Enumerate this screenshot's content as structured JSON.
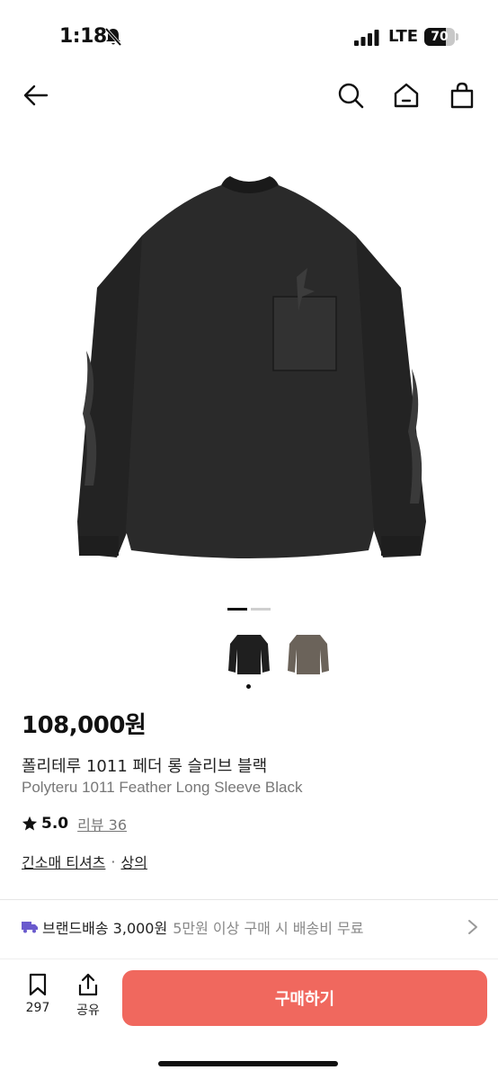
{
  "status_bar": {
    "time": "1:18",
    "network": "LTE",
    "battery": "70",
    "battery_level": 0.7
  },
  "nav": {
    "icons": [
      "back-arrow-icon",
      "search-icon",
      "home-icon",
      "shopping-bag-icon"
    ]
  },
  "gallery": {
    "page_count": 2,
    "current_page": 1,
    "thumbnails": [
      {
        "color": "#1f1f1f",
        "selected": true
      },
      {
        "color": "#6b635a",
        "selected": false
      }
    ]
  },
  "product": {
    "price": "108,000원",
    "name_ko": "폴리테루 1011 페더 롱 슬리브 블랙",
    "name_en": "Polyteru 1011 Feather Long Sleeve Black",
    "rating": "5.0",
    "review_label": "리뷰 36",
    "categories": [
      "긴소매 티셔츠",
      "상의"
    ],
    "category_separator": "·"
  },
  "shipping": {
    "label": "브랜드배송 3,000원",
    "note": "5만원 이상 구매 시 배송비 무료"
  },
  "bottom_bar": {
    "save_count": "297",
    "share_label": "공유",
    "buy_label": "구매하기"
  },
  "colors": {
    "accent": "#f0685e",
    "shipping_icon": "#6a5acd"
  }
}
